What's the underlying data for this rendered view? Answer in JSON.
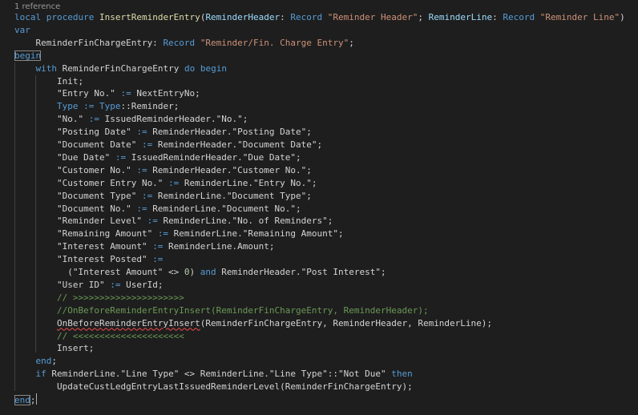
{
  "colors": {
    "background": "#1e1e1e",
    "default": "#d4d4d4",
    "keyword": "#569cd6",
    "control": "#c586c0",
    "string": "#ce9178",
    "type": "#4ec9b0",
    "function": "#dcdcaa",
    "comment": "#6a9955",
    "variable": "#9cdcfe",
    "number": "#b5cea8",
    "codelens": "#999999"
  },
  "codelens": "1 reference",
  "code": [
    [
      [
        "local procedure ",
        "kw"
      ],
      [
        "InsertReminderEntry",
        "fn"
      ],
      [
        "(",
        "d"
      ],
      [
        "ReminderHeader",
        "var"
      ],
      [
        ": ",
        "d"
      ],
      [
        "Record",
        "kw"
      ],
      [
        " ",
        "d"
      ],
      [
        "\"Reminder Header\"",
        "str"
      ],
      [
        "; ",
        "d"
      ],
      [
        "ReminderLine",
        "var"
      ],
      [
        ": ",
        "d"
      ],
      [
        "Record",
        "kw"
      ],
      [
        " ",
        "d"
      ],
      [
        "\"Reminder Line\"",
        "str"
      ],
      [
        ")",
        "d"
      ]
    ],
    [
      [
        "var",
        "kw"
      ]
    ],
    [
      [
        "    ReminderFinChargeEntry: ",
        "d"
      ],
      [
        "Record",
        "kw"
      ],
      [
        " ",
        "d"
      ],
      [
        "\"Reminder/Fin. Charge Entry\"",
        "str"
      ],
      [
        ";",
        "d"
      ]
    ],
    [
      [
        "begin",
        "kw",
        "boxed"
      ]
    ],
    [
      [
        "    ",
        "d"
      ],
      [
        "with",
        "kw"
      ],
      [
        " ReminderFinChargeEntry ",
        "d"
      ],
      [
        "do",
        "kw"
      ],
      [
        " ",
        "d"
      ],
      [
        "begin",
        "kw"
      ]
    ],
    [
      [
        "        Init;",
        "d"
      ]
    ],
    [
      [
        "        \"Entry No.\" ",
        "d"
      ],
      [
        ":=",
        "kw"
      ],
      [
        " NextEntryNo;",
        "d"
      ]
    ],
    [
      [
        "        ",
        "d"
      ],
      [
        "Type",
        "kw"
      ],
      [
        " ",
        "d"
      ],
      [
        ":=",
        "kw"
      ],
      [
        " ",
        "d"
      ],
      [
        "Type",
        "kw"
      ],
      [
        "::Reminder;",
        "d"
      ]
    ],
    [
      [
        "        \"No.\" ",
        "d"
      ],
      [
        ":=",
        "kw"
      ],
      [
        " IssuedReminderHeader.\"No.\";",
        "d"
      ]
    ],
    [
      [
        "        \"Posting Date\" ",
        "d"
      ],
      [
        ":=",
        "kw"
      ],
      [
        " ReminderHeader.\"Posting Date\";",
        "d"
      ]
    ],
    [
      [
        "        \"Document Date\" ",
        "d"
      ],
      [
        ":=",
        "kw"
      ],
      [
        " ReminderHeader.\"Document Date\";",
        "d"
      ]
    ],
    [
      [
        "        \"Due Date\" ",
        "d"
      ],
      [
        ":=",
        "kw"
      ],
      [
        " IssuedReminderHeader.\"Due Date\";",
        "d"
      ]
    ],
    [
      [
        "        \"Customer No.\" ",
        "d"
      ],
      [
        ":=",
        "kw"
      ],
      [
        " ReminderHeader.\"Customer No.\";",
        "d"
      ]
    ],
    [
      [
        "        \"Customer Entry No.\" ",
        "d"
      ],
      [
        ":=",
        "kw"
      ],
      [
        " ReminderLine.\"Entry No.\";",
        "d"
      ]
    ],
    [
      [
        "        \"Document Type\" ",
        "d"
      ],
      [
        ":=",
        "kw"
      ],
      [
        " ReminderLine.\"Document Type\";",
        "d"
      ]
    ],
    [
      [
        "        \"Document No.\" ",
        "d"
      ],
      [
        ":=",
        "kw"
      ],
      [
        " ReminderLine.\"Document No.\";",
        "d"
      ]
    ],
    [
      [
        "        \"Reminder Level\" ",
        "d"
      ],
      [
        ":=",
        "kw"
      ],
      [
        " ReminderLine.\"No. of Reminders\";",
        "d"
      ]
    ],
    [
      [
        "        \"Remaining Amount\" ",
        "d"
      ],
      [
        ":=",
        "kw"
      ],
      [
        " ReminderLine.\"Remaining Amount\";",
        "d"
      ]
    ],
    [
      [
        "        \"Interest Amount\" ",
        "d"
      ],
      [
        ":=",
        "kw"
      ],
      [
        " ReminderLine.Amount;",
        "d"
      ]
    ],
    [
      [
        "        \"Interest Posted\" ",
        "d"
      ],
      [
        ":=",
        "kw"
      ]
    ],
    [
      [
        "          (\"Interest Amount\" <> ",
        "d"
      ],
      [
        "0",
        "num"
      ],
      [
        ") ",
        "d"
      ],
      [
        "and",
        "kw"
      ],
      [
        " ReminderHeader.\"Post Interest\";",
        "d"
      ]
    ],
    [
      [
        "        \"User ID\" ",
        "d"
      ],
      [
        ":=",
        "kw"
      ],
      [
        " UserId;",
        "d"
      ]
    ],
    [
      [
        "        ",
        "d"
      ],
      [
        "// >>>>>>>>>>>>>>>>>>>>>",
        "cmt"
      ]
    ],
    [
      [
        "        ",
        "d"
      ],
      [
        "//OnBeforeReminderEntryInsert(ReminderFinChargeEntry, ReminderHeader);",
        "cmt"
      ]
    ],
    [
      [
        "        ",
        "d"
      ],
      [
        "OnBeforeReminderEntryInsert",
        "d",
        "sq"
      ],
      [
        "(ReminderFinChargeEntry, ReminderHeader, ReminderLine);",
        "d"
      ]
    ],
    [
      [
        "        ",
        "d"
      ],
      [
        "// <<<<<<<<<<<<<<<<<<<<<",
        "cmt"
      ]
    ],
    [
      [
        "        Insert;",
        "d"
      ]
    ],
    [
      [
        "    ",
        "d"
      ],
      [
        "end",
        "kw"
      ],
      [
        ";",
        "d"
      ]
    ],
    [
      [
        "    ",
        "d"
      ],
      [
        "if",
        "kw"
      ],
      [
        " ReminderLine.\"Line Type\" <> ReminderLine.\"Line Type\"::\"Not Due\" ",
        "d"
      ],
      [
        "then",
        "kw"
      ]
    ],
    [
      [
        "        UpdateCustLedgEntryLastIssuedReminderLevel(ReminderFinChargeEntry);",
        "d"
      ]
    ],
    [
      [
        "end",
        "kw",
        "boxed"
      ],
      [
        ";",
        "d"
      ],
      [
        "",
        "d",
        "caret"
      ]
    ]
  ]
}
